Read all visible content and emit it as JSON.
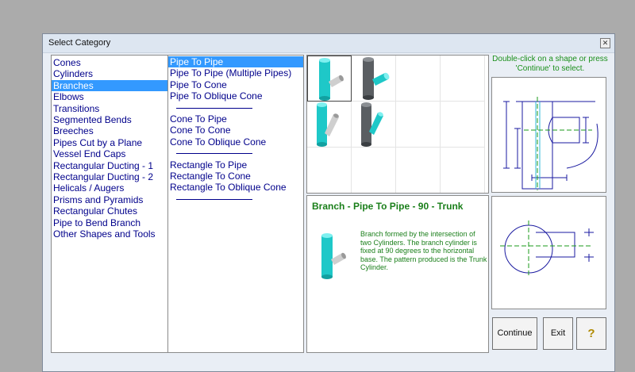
{
  "window": {
    "title": "Select Category"
  },
  "categories": [
    "Cones",
    "Cylinders",
    "Branches",
    "Elbows",
    "Transitions",
    "Segmented Bends",
    "Breeches",
    "Pipes Cut by a Plane",
    "Vessel End Caps",
    "Rectangular Ducting - 1",
    "Rectangular Ducting - 2",
    "Helicals / Augers",
    "Prisms and Pyramids",
    "Rectangular Chutes",
    "Pipe to Bend Branch",
    "Other Shapes and Tools"
  ],
  "selected_category": "Branches",
  "subtypes": [
    {
      "label": "Pipe To Pipe",
      "selected": true
    },
    {
      "label": "Pipe To Pipe (Multiple Pipes)"
    },
    {
      "label": "Pipe To Cone"
    },
    {
      "label": "Pipe To Oblique Cone"
    },
    {
      "sep": true
    },
    {
      "label": "Cone To Pipe"
    },
    {
      "label": "Cone To Cone"
    },
    {
      "label": "Cone To Oblique Cone"
    },
    {
      "sep": true
    },
    {
      "label": "Rectangle To Pipe"
    },
    {
      "label": "Rectangle To Cone"
    },
    {
      "label": "Rectangle To Oblique Cone"
    },
    {
      "sep": true
    }
  ],
  "hint": "Double-click on a shape or press 'Continue' to select.",
  "description": {
    "title": "Branch - Pipe To Pipe - 90 - Trunk",
    "text": "Branch formed by the intersection of two Cylinders.  The branch cylinder is fixed at 90 degrees to the horizontal base.  The pattern produced is the Trunk Cylinder."
  },
  "buttons": {
    "continue": "Continue",
    "exit": "Exit",
    "help": "?"
  },
  "colors": {
    "cyan": "#1ec8c8",
    "gray": "#606468",
    "drawing_blue": "#1a1aa0",
    "drawing_green": "#1a9a1a",
    "selection": "#3399ff"
  },
  "icons": {
    "thumb_1": "pipe-branch-cyan-icon",
    "thumb_2": "pipe-branch-gray-icon",
    "thumb_3": "pipe-angled-cyan-icon",
    "thumb_4": "pipe-angled-gray-icon"
  }
}
